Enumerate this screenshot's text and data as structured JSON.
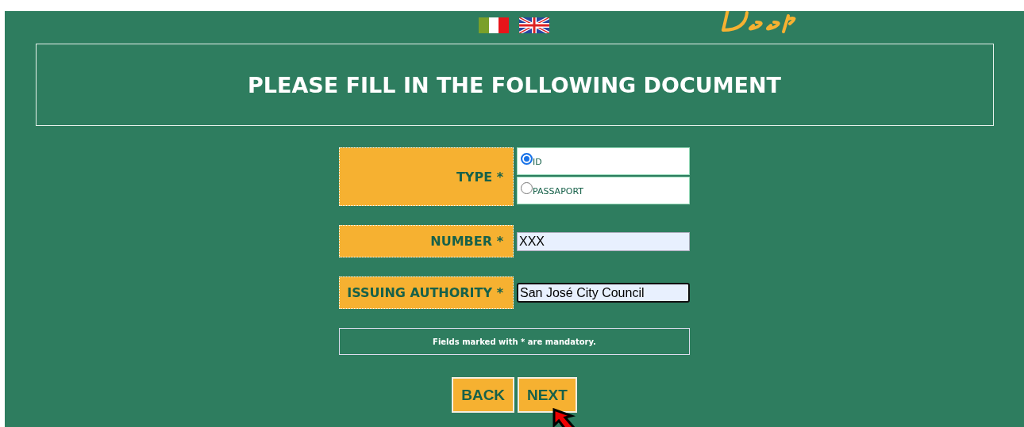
{
  "title": "PLEASE FILL IN THE FOLLOWING DOCUMENT",
  "form": [
    {
      "kind": "radio",
      "label": "TYPE *",
      "options": [
        {
          "label": "ID",
          "selected": true
        },
        {
          "label": "PASSAPORT",
          "selected": false
        }
      ]
    },
    {
      "kind": "text",
      "label": "NUMBER *",
      "value": "XXX",
      "focused": false
    },
    {
      "kind": "text",
      "label": "ISSUING AUTHORITY *",
      "value": "San José City Council",
      "focused": true
    }
  ],
  "note": "Fields marked with * are mandatory.",
  "buttons": [
    "BACK",
    "NEXT"
  ]
}
